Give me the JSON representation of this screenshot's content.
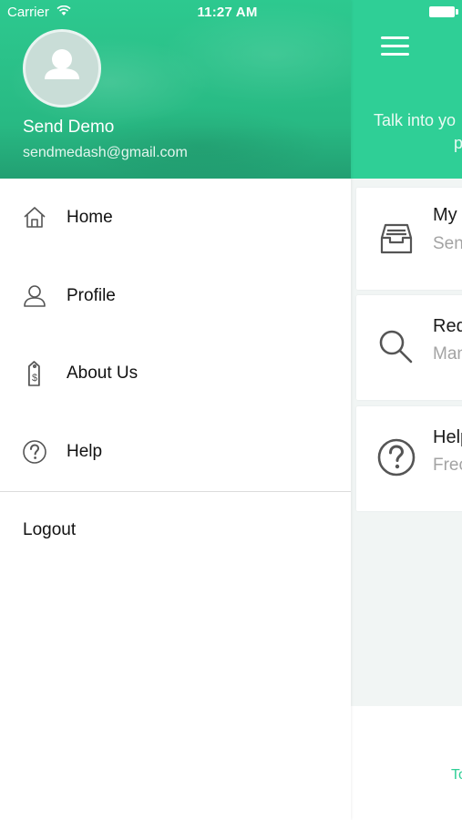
{
  "status_bar": {
    "carrier": "Carrier",
    "time": "11:27 AM"
  },
  "drawer": {
    "user": {
      "name": "Send Demo",
      "email": "sendmedash@gmail.com"
    },
    "menu": [
      {
        "label": "Home",
        "icon": "home-icon"
      },
      {
        "label": "Profile",
        "icon": "person-icon"
      },
      {
        "label": "About Us",
        "icon": "price-tag-icon"
      },
      {
        "label": "Help",
        "icon": "question-circle-icon"
      }
    ],
    "logout_label": "Logout"
  },
  "main": {
    "header_text_line1": "Talk into yo",
    "header_text_line2": "p",
    "cards": [
      {
        "title": "My S",
        "subtitle": "Send",
        "icon": "inbox-tray-icon"
      },
      {
        "title": "Req",
        "subtitle": "Man",
        "icon": "search-icon"
      },
      {
        "title": "Help",
        "subtitle": "Frec",
        "icon": "question-circle-icon"
      }
    ],
    "footer_text": "To"
  },
  "colors": {
    "accent": "#2fcf96",
    "header_dark": "#229f72",
    "text": "#111111",
    "muted": "#a3a3a3"
  }
}
